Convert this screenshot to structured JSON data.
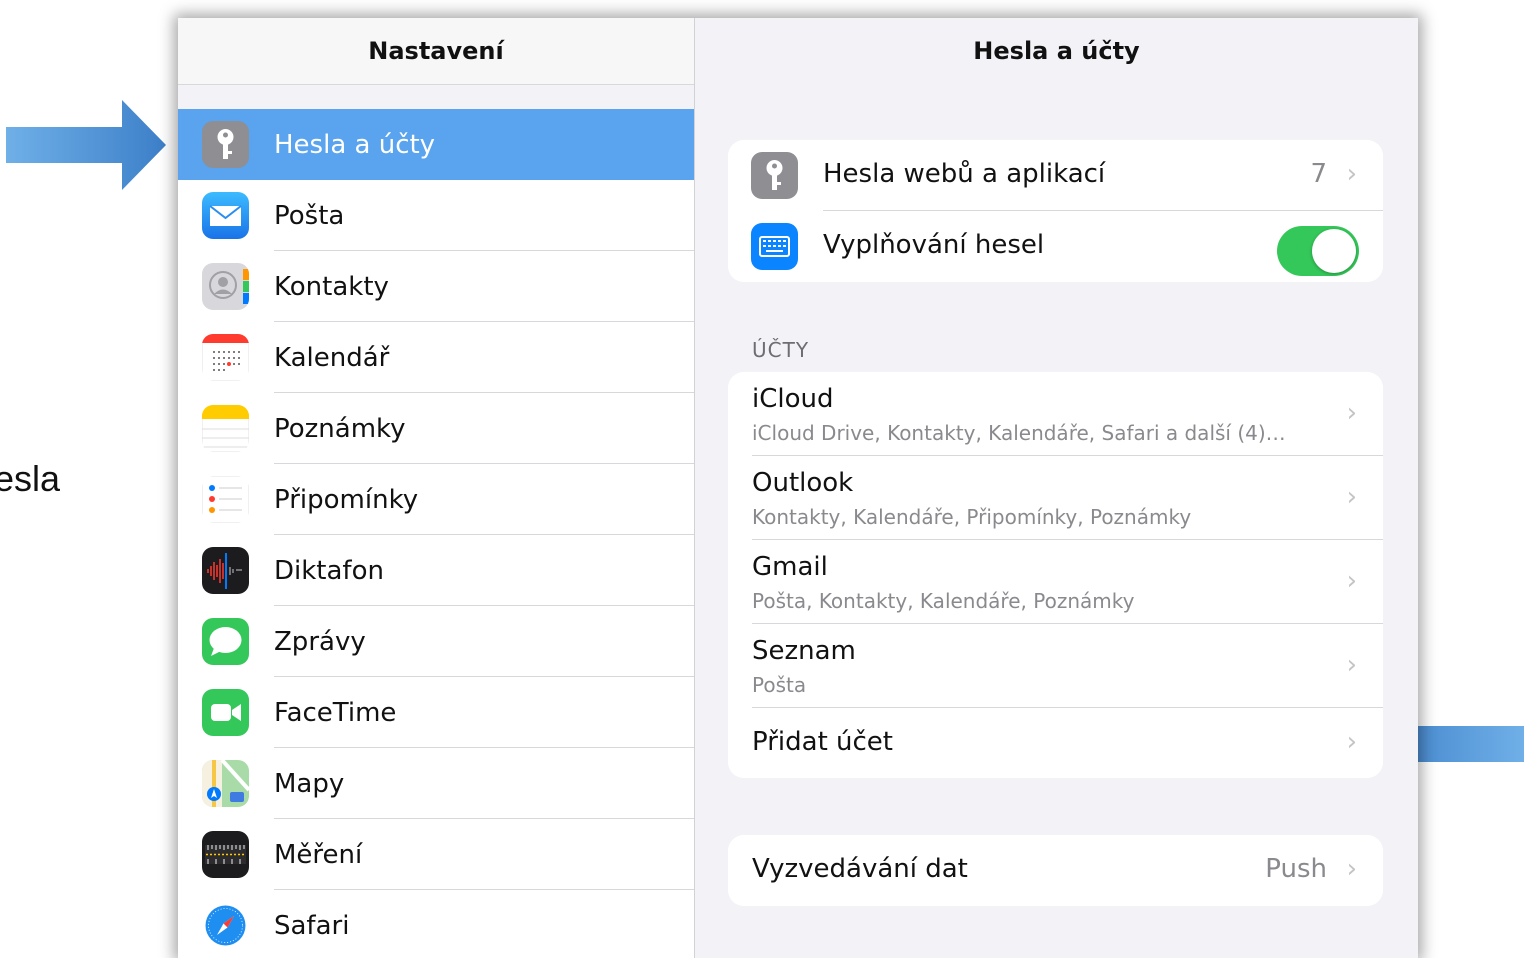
{
  "slide": {
    "fragment_text": "Hesla"
  },
  "sidebar": {
    "title": "Nastavení",
    "items": [
      {
        "label": "Hesla a účty",
        "icon": "key-icon",
        "active": true
      },
      {
        "label": "Pošta",
        "icon": "mail-icon"
      },
      {
        "label": "Kontakty",
        "icon": "contacts-icon"
      },
      {
        "label": "Kalendář",
        "icon": "calendar-icon"
      },
      {
        "label": "Poznámky",
        "icon": "notes-icon"
      },
      {
        "label": "Připomínky",
        "icon": "reminders-icon"
      },
      {
        "label": "Diktafon",
        "icon": "voice-memos-icon"
      },
      {
        "label": "Zprávy",
        "icon": "messages-icon"
      },
      {
        "label": "FaceTime",
        "icon": "facetime-icon"
      },
      {
        "label": "Mapy",
        "icon": "maps-icon"
      },
      {
        "label": "Měření",
        "icon": "measure-icon"
      },
      {
        "label": "Safari",
        "icon": "safari-icon"
      }
    ]
  },
  "detail": {
    "title": "Hesla a účty",
    "passwords": {
      "label": "Hesla webů a aplikací",
      "count": "7"
    },
    "autofill": {
      "label": "Vyplňování hesel",
      "enabled": true
    },
    "accounts_header": "ÚČTY",
    "accounts": [
      {
        "name": "iCloud",
        "services": "iCloud Drive, Kontakty, Kalendáře, Safari a další (4)…"
      },
      {
        "name": "Outlook",
        "services": "Kontakty, Kalendáře, Připomínky, Poznámky"
      },
      {
        "name": "Gmail",
        "services": "Pošta, Kontakty, Kalendáře, Poznámky"
      },
      {
        "name": "Seznam",
        "services": "Pošta"
      }
    ],
    "add_account": "Přidat účet",
    "fetch": {
      "label": "Vyzvedávání dat",
      "value": "Push"
    }
  },
  "colors": {
    "active_row": "#5aa3ee",
    "toggle_on": "#34c759",
    "arrow": "#4a90d9"
  }
}
